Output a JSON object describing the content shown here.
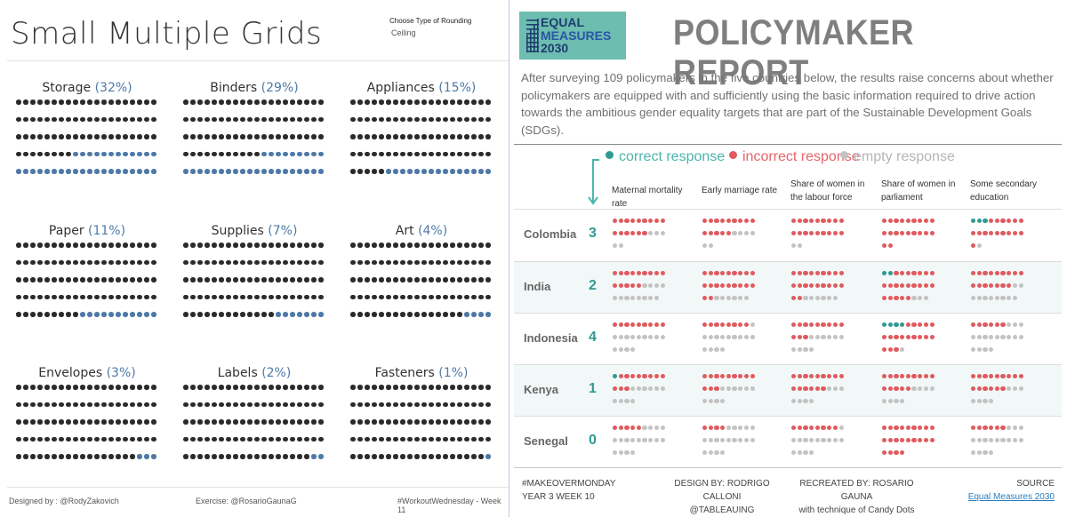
{
  "left": {
    "title": "Small Multiple Grids",
    "rounding": {
      "label": "Choose Type of Rounding",
      "value": "Ceiling"
    },
    "footer": {
      "designed_by": "Designed by : @RodyZakovich",
      "exercise": "Exercise: @RosarioGaunaG",
      "tag": "#WorkoutWednesday - Week 11"
    },
    "colors": {
      "base": "#2b2b2b",
      "highlight": "#4e79a7"
    },
    "grid_rows": 5,
    "grid_cols": 20,
    "grids": [
      {
        "name": "Storage",
        "pct_label": "(32%)",
        "percent": 32
      },
      {
        "name": "Binders",
        "pct_label": "(29%)",
        "percent": 29
      },
      {
        "name": "Appliances",
        "pct_label": "(15%)",
        "percent": 15
      },
      {
        "name": "Paper",
        "pct_label": "(11%)",
        "percent": 11
      },
      {
        "name": "Supplies",
        "pct_label": "(7%)",
        "percent": 7
      },
      {
        "name": "Art",
        "pct_label": "(4%)",
        "percent": 4
      },
      {
        "name": "Envelopes",
        "pct_label": "(3%)",
        "percent": 3
      },
      {
        "name": "Labels",
        "pct_label": "(2%)",
        "percent": 2
      },
      {
        "name": "Fasteners",
        "pct_label": "(1%)",
        "percent": 1
      }
    ]
  },
  "right": {
    "logo": {
      "line1": "EQUAL",
      "line2": "MEASURES",
      "line3": "2030"
    },
    "title": "POLICYMAKER REPORT",
    "intro": "After surveying 109 policymakers in the five countries below, the results raise concerns about whether policymakers are equipped with and sufficiently using the basic information required to drive action towards the ambitious gender equality targets that are part of the Sustainable Development Goals (SDGs).",
    "legend": [
      {
        "key": "correct",
        "label": "correct response",
        "color": "#2f9a91",
        "text_color": "#4ab5ab"
      },
      {
        "key": "incorrect",
        "label": "incorrect response",
        "color": "#e05a5e",
        "text_color": "#e8646a"
      },
      {
        "key": "empty",
        "label": "empty response",
        "color": "#c3c3c3",
        "text_color": "#b5b5b5"
      }
    ],
    "columns": [
      "Maternal mortality rate",
      "Early marriage rate",
      "Share of women in the labour force",
      "Share of women in parliament",
      "Some secondary education"
    ],
    "countries": [
      {
        "name": "Colombia",
        "score": "3",
        "cells": [
          {
            "correct": 0,
            "incorrect": 15,
            "empty": 5
          },
          {
            "correct": 0,
            "incorrect": 14,
            "empty": 6
          },
          {
            "correct": 0,
            "incorrect": 18,
            "empty": 2
          },
          {
            "correct": 0,
            "incorrect": 20,
            "empty": 0
          },
          {
            "correct": 3,
            "incorrect": 16,
            "empty": 1
          }
        ]
      },
      {
        "name": "India",
        "score": "2",
        "cells": [
          {
            "correct": 0,
            "incorrect": 14,
            "empty": 12
          },
          {
            "correct": 0,
            "incorrect": 20,
            "empty": 6
          },
          {
            "correct": 0,
            "incorrect": 20,
            "empty": 6
          },
          {
            "correct": 2,
            "incorrect": 21,
            "empty": 3
          },
          {
            "correct": 0,
            "incorrect": 16,
            "empty": 10
          }
        ]
      },
      {
        "name": "Indonesia",
        "score": "4",
        "cells": [
          {
            "correct": 0,
            "incorrect": 9,
            "empty": 13
          },
          {
            "correct": 0,
            "incorrect": 8,
            "empty": 14
          },
          {
            "correct": 0,
            "incorrect": 12,
            "empty": 10
          },
          {
            "correct": 4,
            "incorrect": 17,
            "empty": 1
          },
          {
            "correct": 0,
            "incorrect": 6,
            "empty": 16
          }
        ]
      },
      {
        "name": "Kenya",
        "score": "1",
        "cells": [
          {
            "correct": 1,
            "incorrect": 11,
            "empty": 10
          },
          {
            "correct": 0,
            "incorrect": 12,
            "empty": 10
          },
          {
            "correct": 0,
            "incorrect": 15,
            "empty": 7
          },
          {
            "correct": 0,
            "incorrect": 14,
            "empty": 8
          },
          {
            "correct": 0,
            "incorrect": 15,
            "empty": 7
          }
        ]
      },
      {
        "name": "Senegal",
        "score": "0",
        "cells": [
          {
            "correct": 0,
            "incorrect": 5,
            "empty": 17
          },
          {
            "correct": 0,
            "incorrect": 4,
            "empty": 18
          },
          {
            "correct": 0,
            "incorrect": 8,
            "empty": 14
          },
          {
            "correct": 0,
            "incorrect": 22,
            "empty": 0
          },
          {
            "correct": 0,
            "incorrect": 6,
            "empty": 16
          }
        ]
      }
    ],
    "footer": {
      "makeover_line1": "#MAKEOVERMONDAY",
      "makeover_line2": "YEAR 3 WEEK 10",
      "design_line1": "DESIGN BY: RODRIGO CALLONI",
      "design_line2": "@TABLEAUING",
      "recreated_line1": "RECREATED BY: ROSARIO GAUNA",
      "recreated_line2": "with technique of Candy Dots",
      "source_label": "SOURCE",
      "source_link": "Equal Measures 2030"
    }
  }
}
